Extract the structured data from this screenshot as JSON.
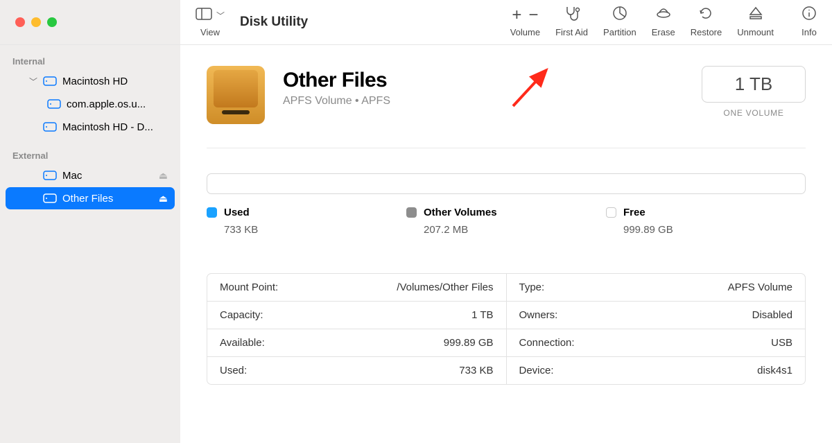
{
  "toolbar": {
    "view_label": "View",
    "app_title": "Disk Utility",
    "volume_label": "Volume",
    "first_aid_label": "First Aid",
    "partition_label": "Partition",
    "erase_label": "Erase",
    "restore_label": "Restore",
    "unmount_label": "Unmount",
    "info_label": "Info"
  },
  "sidebar": {
    "internal_section": "Internal",
    "external_section": "External",
    "items": {
      "int_parent": "Macintosh HD",
      "int_child1": "com.apple.os.u...",
      "int_child2": "Macintosh HD - D...",
      "ext_mac": "Mac",
      "ext_other": "Other Files"
    }
  },
  "volume": {
    "title": "Other Files",
    "subtitle": "APFS Volume • APFS",
    "capacity_label": "1 TB",
    "capacity_sub": "ONE VOLUME"
  },
  "usage": {
    "used_label": "Used",
    "used_value": "733 KB",
    "other_label": "Other Volumes",
    "other_value": "207.2 MB",
    "free_label": "Free",
    "free_value": "999.89 GB"
  },
  "info": {
    "mount_point_k": "Mount Point:",
    "mount_point_v": "/Volumes/Other Files",
    "capacity_k": "Capacity:",
    "capacity_v": "1 TB",
    "available_k": "Available:",
    "available_v": "999.89 GB",
    "used_k": "Used:",
    "used_v": "733 KB",
    "type_k": "Type:",
    "type_v": "APFS Volume",
    "owners_k": "Owners:",
    "owners_v": "Disabled",
    "connection_k": "Connection:",
    "connection_v": "USB",
    "device_k": "Device:",
    "device_v": "disk4s1"
  }
}
